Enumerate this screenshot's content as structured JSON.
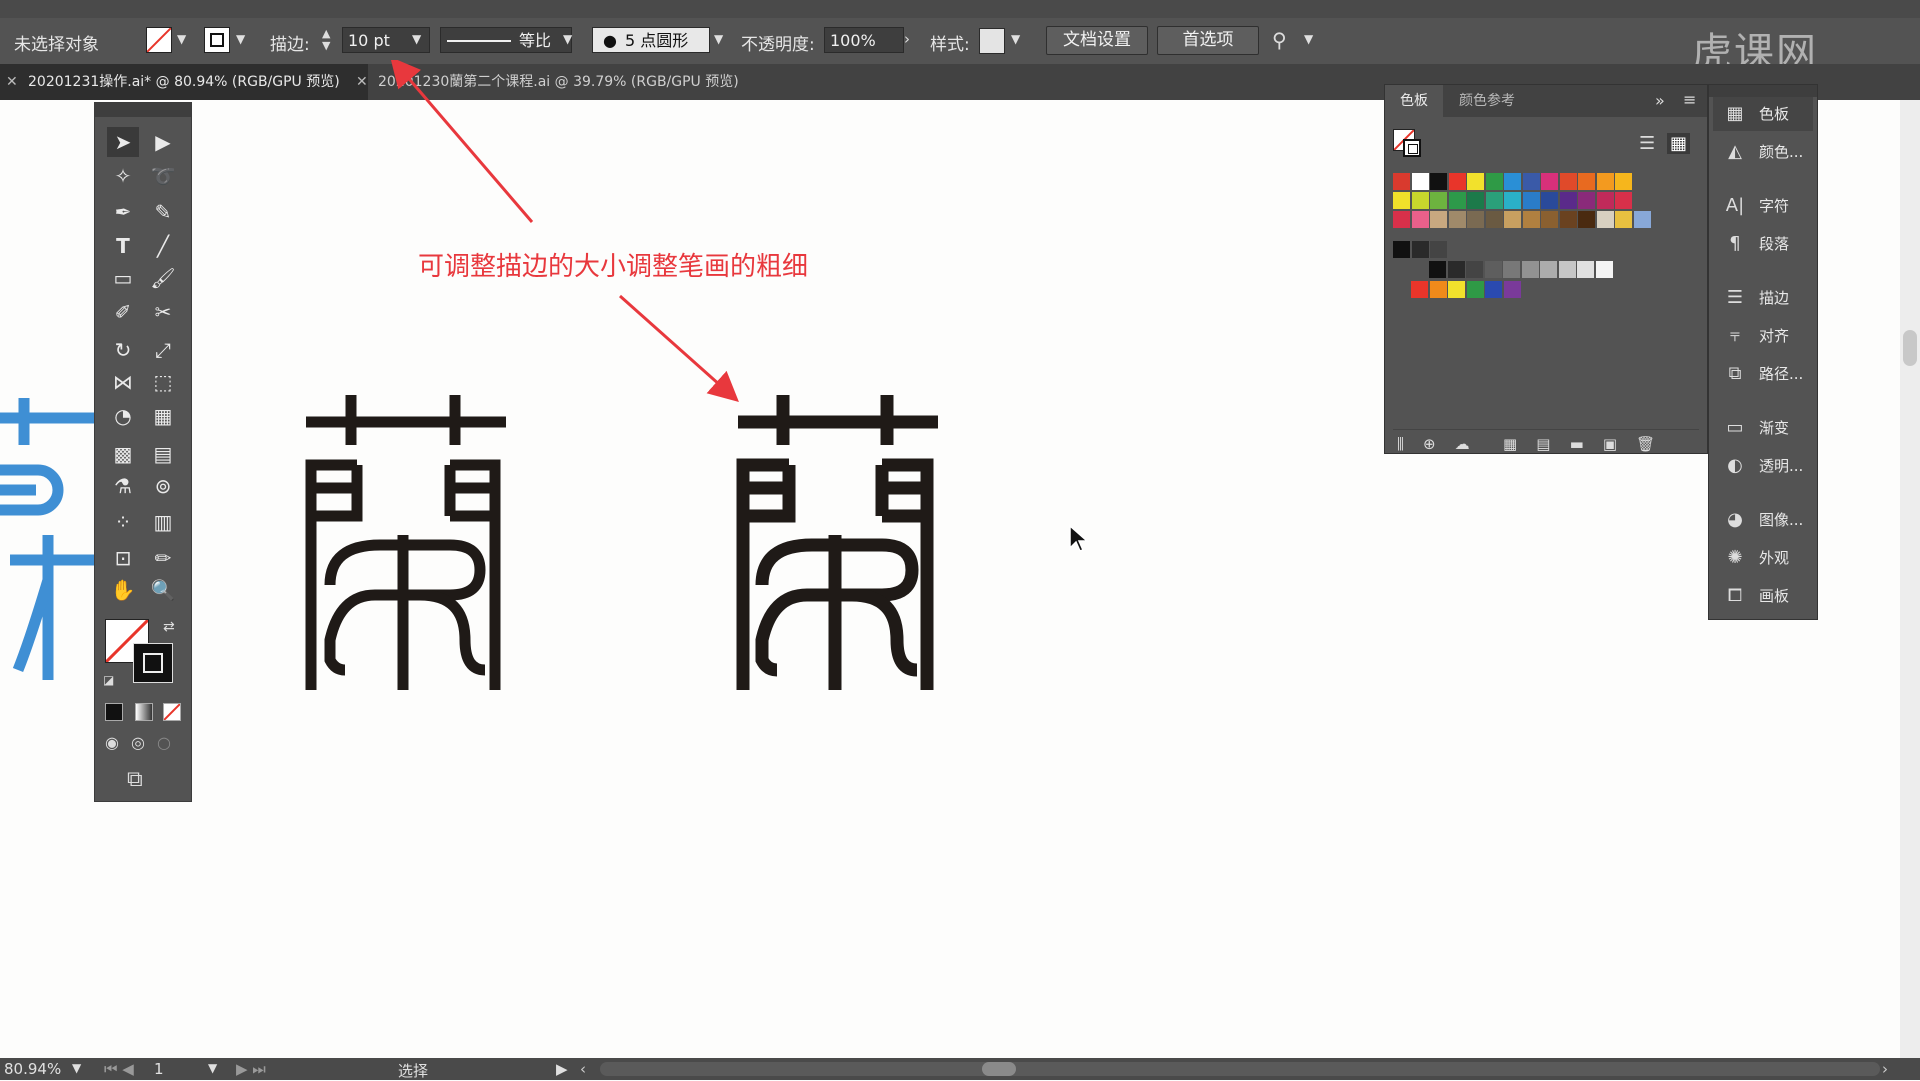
{
  "control_bar": {
    "selection_label": "未选择对象",
    "stroke_label": "描边:",
    "stroke_value": "10 pt",
    "stroke_profile": "等比",
    "brush_label": "5 点圆形",
    "opacity_label": "不透明度:",
    "opacity_value": "100%",
    "style_label": "样式:",
    "doc_setup_button": "文档设置",
    "preferences_button": "首选项"
  },
  "tabs": [
    {
      "label": "20201231操作.ai* @ 80.94% (RGB/GPU 预览)"
    },
    {
      "label": "20201230蘭第二个课程.ai @ 39.79% (RGB/GPU 预览)"
    }
  ],
  "watermark": "虎课网",
  "annotation": "可调整描边的大小调整笔画的粗细",
  "swatch_panel": {
    "tab_swatches": "色板",
    "tab_color_guide": "颜色参考",
    "colors_row1": [
      "#d93a2e",
      "#ffffff",
      "#111111",
      "#e8352a",
      "#f2e12c",
      "#2f9a46",
      "#2a8fd6",
      "#3a5aa8",
      "#d8307a",
      "#e04a2a",
      "#e86a20",
      "#f39a1f",
      "#f6b61c"
    ],
    "colors_row2": [
      "#f0e02a",
      "#c9d62c",
      "#6db33f",
      "#2d9a4a",
      "#1c7a4a",
      "#2aa07a",
      "#2ab0c8",
      "#2a7cc8",
      "#2a4a9a",
      "#5a2a8a",
      "#8a2a7a",
      "#c02a5a",
      "#d8304a"
    ],
    "colors_row3": [
      "#d8304a",
      "#e8608a",
      "#c8a880",
      "#a08a6a",
      "#7a6a52",
      "#6a5a42",
      "#c8a060",
      "#b08040",
      "#8a6030",
      "#6a4220",
      "#4a2a10",
      "#d8d0c0",
      "#e8c040",
      "#88a8d8"
    ],
    "grays": [
      "#111111",
      "#2a2a2a",
      "#444444",
      "#5e5e5e",
      "#787878",
      "#929292",
      "#acacac",
      "#c6c6c6",
      "#e0e0e0",
      "#f4f4f4"
    ],
    "brights": [
      "#e8352a",
      "#f08a1a",
      "#f2e12c",
      "#2f9a46",
      "#2a4ab0",
      "#7a3a9a"
    ]
  },
  "side_panel": {
    "items": [
      {
        "icon": "swatches-icon",
        "label": "色板"
      },
      {
        "icon": "color-icon",
        "label": "颜色..."
      },
      {
        "icon": "character-icon",
        "label": "字符"
      },
      {
        "icon": "paragraph-icon",
        "label": "段落"
      },
      {
        "icon": "stroke-icon",
        "label": "描边"
      },
      {
        "icon": "align-icon",
        "label": "对齐"
      },
      {
        "icon": "pathfinder-icon",
        "label": "路径..."
      },
      {
        "icon": "gradient-icon",
        "label": "渐变"
      },
      {
        "icon": "transparency-icon",
        "label": "透明..."
      },
      {
        "icon": "image-trace-icon",
        "label": "图像..."
      },
      {
        "icon": "appearance-icon",
        "label": "外观"
      },
      {
        "icon": "artboards-icon",
        "label": "画板"
      }
    ]
  },
  "status_bar": {
    "zoom": "80.94%",
    "page": "1",
    "tool_name": "选择"
  },
  "colors": {
    "accent_red": "#e8383d",
    "glyph_black": "#1f1a17",
    "glyph_blue": "#3f8fd4"
  }
}
